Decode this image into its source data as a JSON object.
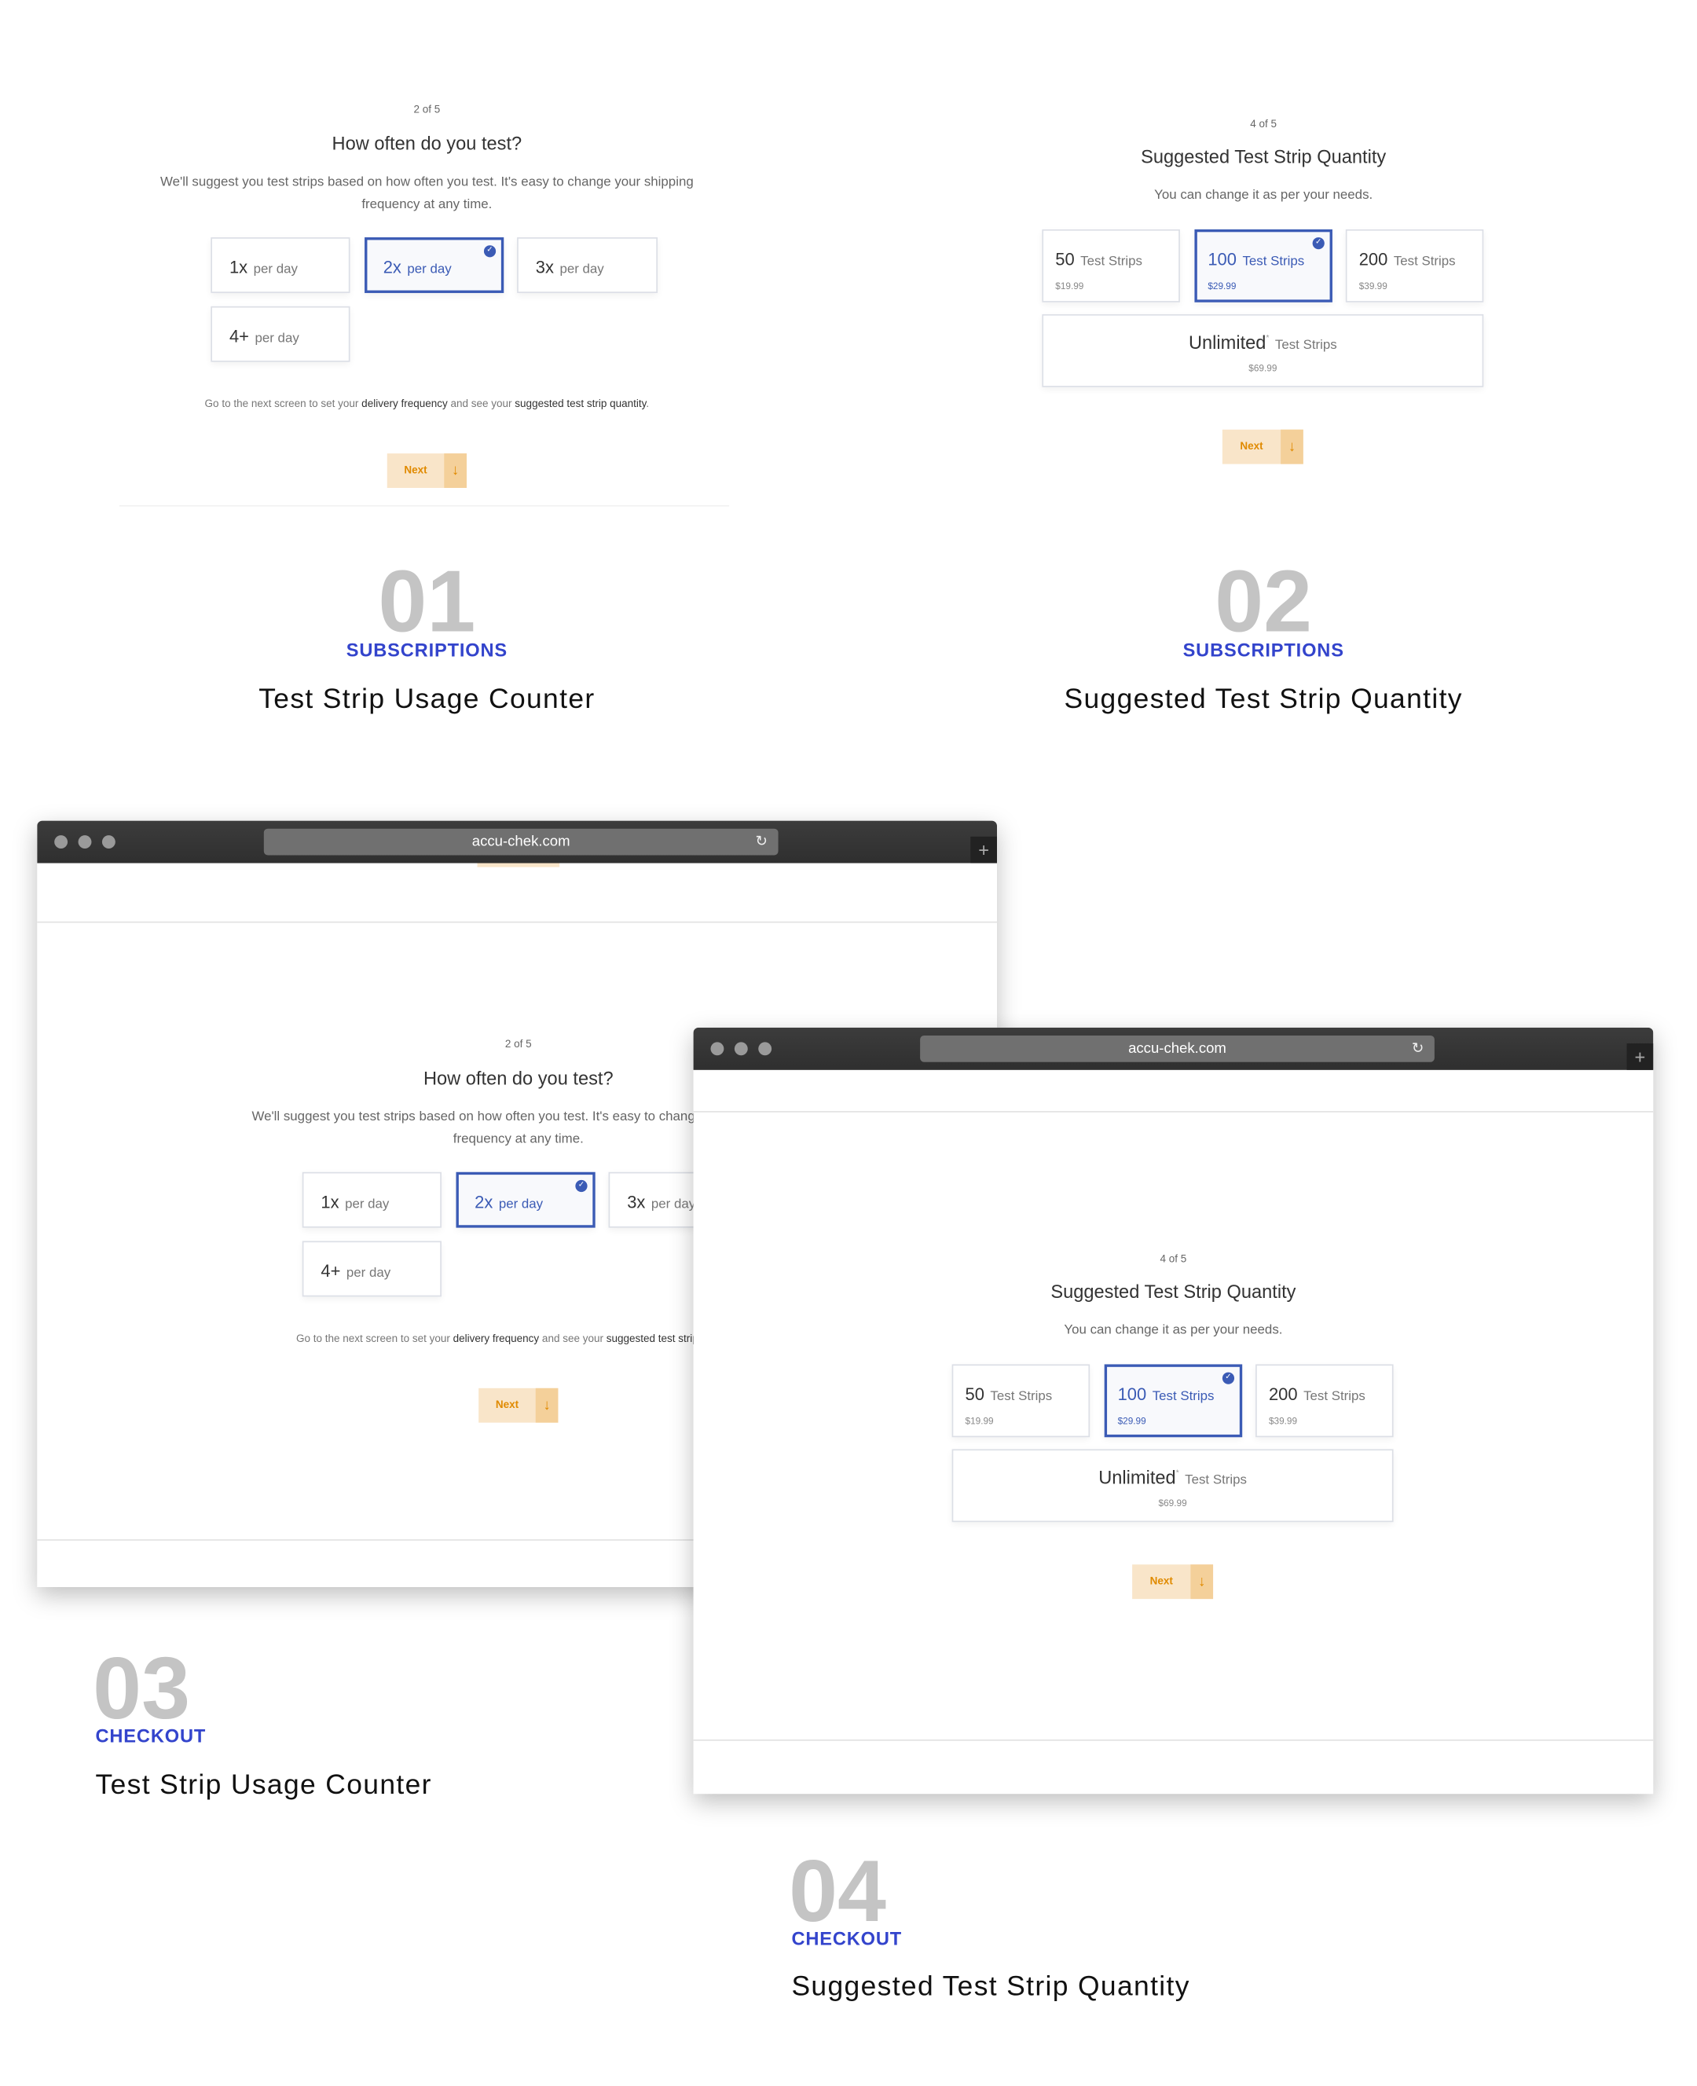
{
  "frequency_screen": {
    "step": "2 of 5",
    "title": "How often do you test?",
    "description": "We'll suggest you test strips based on how often you test. It's easy to change your shipping frequency at any time.",
    "options": [
      {
        "value": "1x",
        "unit": "per day",
        "selected": false
      },
      {
        "value": "2x",
        "unit": "per day",
        "selected": true
      },
      {
        "value": "3x",
        "unit": "per day",
        "selected": false
      },
      {
        "value": "4+",
        "unit": "per day",
        "selected": false
      }
    ],
    "footer_pre": "Go to the next screen to set your ",
    "footer_b1": "delivery frequency",
    "footer_mid": " and see your ",
    "footer_b2": "suggested test strip quantity",
    "footer_end": ".",
    "next": "Next",
    "next_icon": "arrow-down-icon"
  },
  "quantity_screen": {
    "step": "4 of 5",
    "title": "Suggested Test Strip Quantity",
    "subtitle": "You can change it as per your needs.",
    "options": [
      {
        "count": "50",
        "unit": "Test Strips",
        "price": "$19.99",
        "selected": false
      },
      {
        "count": "100",
        "unit": "Test Strips",
        "price": "$29.99",
        "selected": true
      },
      {
        "count": "200",
        "unit": "Test Strips",
        "price": "$39.99",
        "selected": false
      }
    ],
    "unlimited": {
      "count": "Unlimited",
      "mark": "*",
      "unit": "Test Strips",
      "price": "$69.99"
    },
    "next": "Next"
  },
  "browser": {
    "url": "accu-chek.com"
  },
  "labels": [
    {
      "num": "01",
      "category": "SUBSCRIPTIONS",
      "title": "Test Strip Usage Counter"
    },
    {
      "num": "02",
      "category": "SUBSCRIPTIONS",
      "title": "Suggested Test Strip Quantity"
    },
    {
      "num": "03",
      "category": "CHECKOUT",
      "title": "Test Strip Usage Counter"
    },
    {
      "num": "04",
      "category": "CHECKOUT",
      "title": "Suggested Test Strip Quantity"
    }
  ],
  "colors": {
    "accent": "#3344cc",
    "selected": "#3b5bb5",
    "next_bg": "#f9e5c9",
    "next_text": "#e08a00"
  }
}
